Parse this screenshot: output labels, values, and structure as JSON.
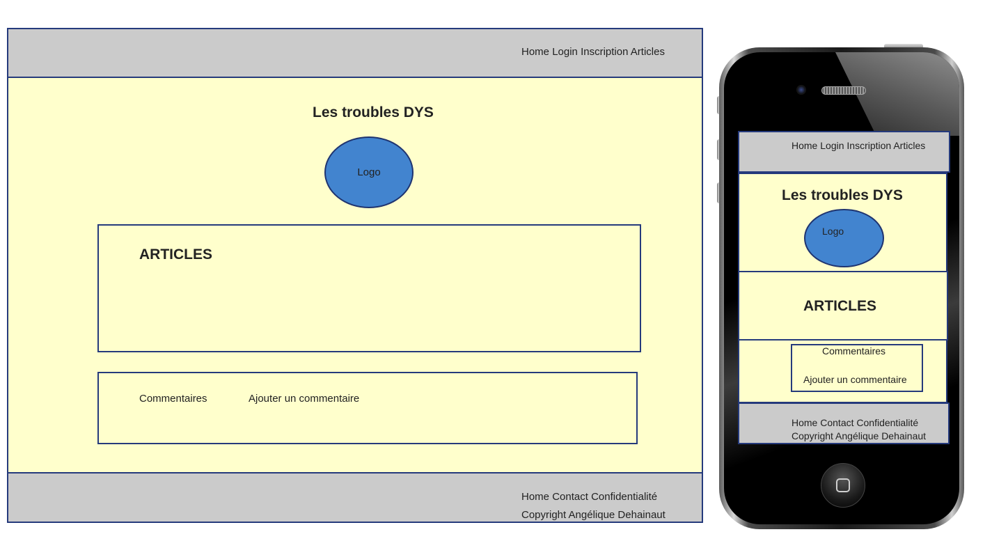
{
  "desktop": {
    "nav": [
      "Home",
      "Login",
      "Inscription",
      "Articles"
    ],
    "title": "Les troubles DYS",
    "logo": "Logo",
    "articles_heading": "ARTICLES",
    "comments_label": "Commentaires",
    "add_comment_label": "Ajouter un commentaire",
    "footer_links": [
      "Home",
      "Contact",
      "Confidentialité"
    ],
    "copyright": "Copyright Angélique Dehainaut"
  },
  "mobile": {
    "nav": [
      "Home",
      "Login",
      "Inscription",
      "Articles"
    ],
    "title": "Les troubles DYS",
    "logo": "Logo",
    "articles_heading": "ARTICLES",
    "comments_label": "Commentaires",
    "add_comment_label": "Ajouter un commentaire",
    "footer_links": [
      "Home",
      "Contact",
      "Confidentialité"
    ],
    "copyright": "Copyright Angélique Dehainaut"
  },
  "colors": {
    "border": "#253a7c",
    "header_footer": "#cbcbcb",
    "content": "#ffffcc",
    "logo": "#4284cf"
  }
}
